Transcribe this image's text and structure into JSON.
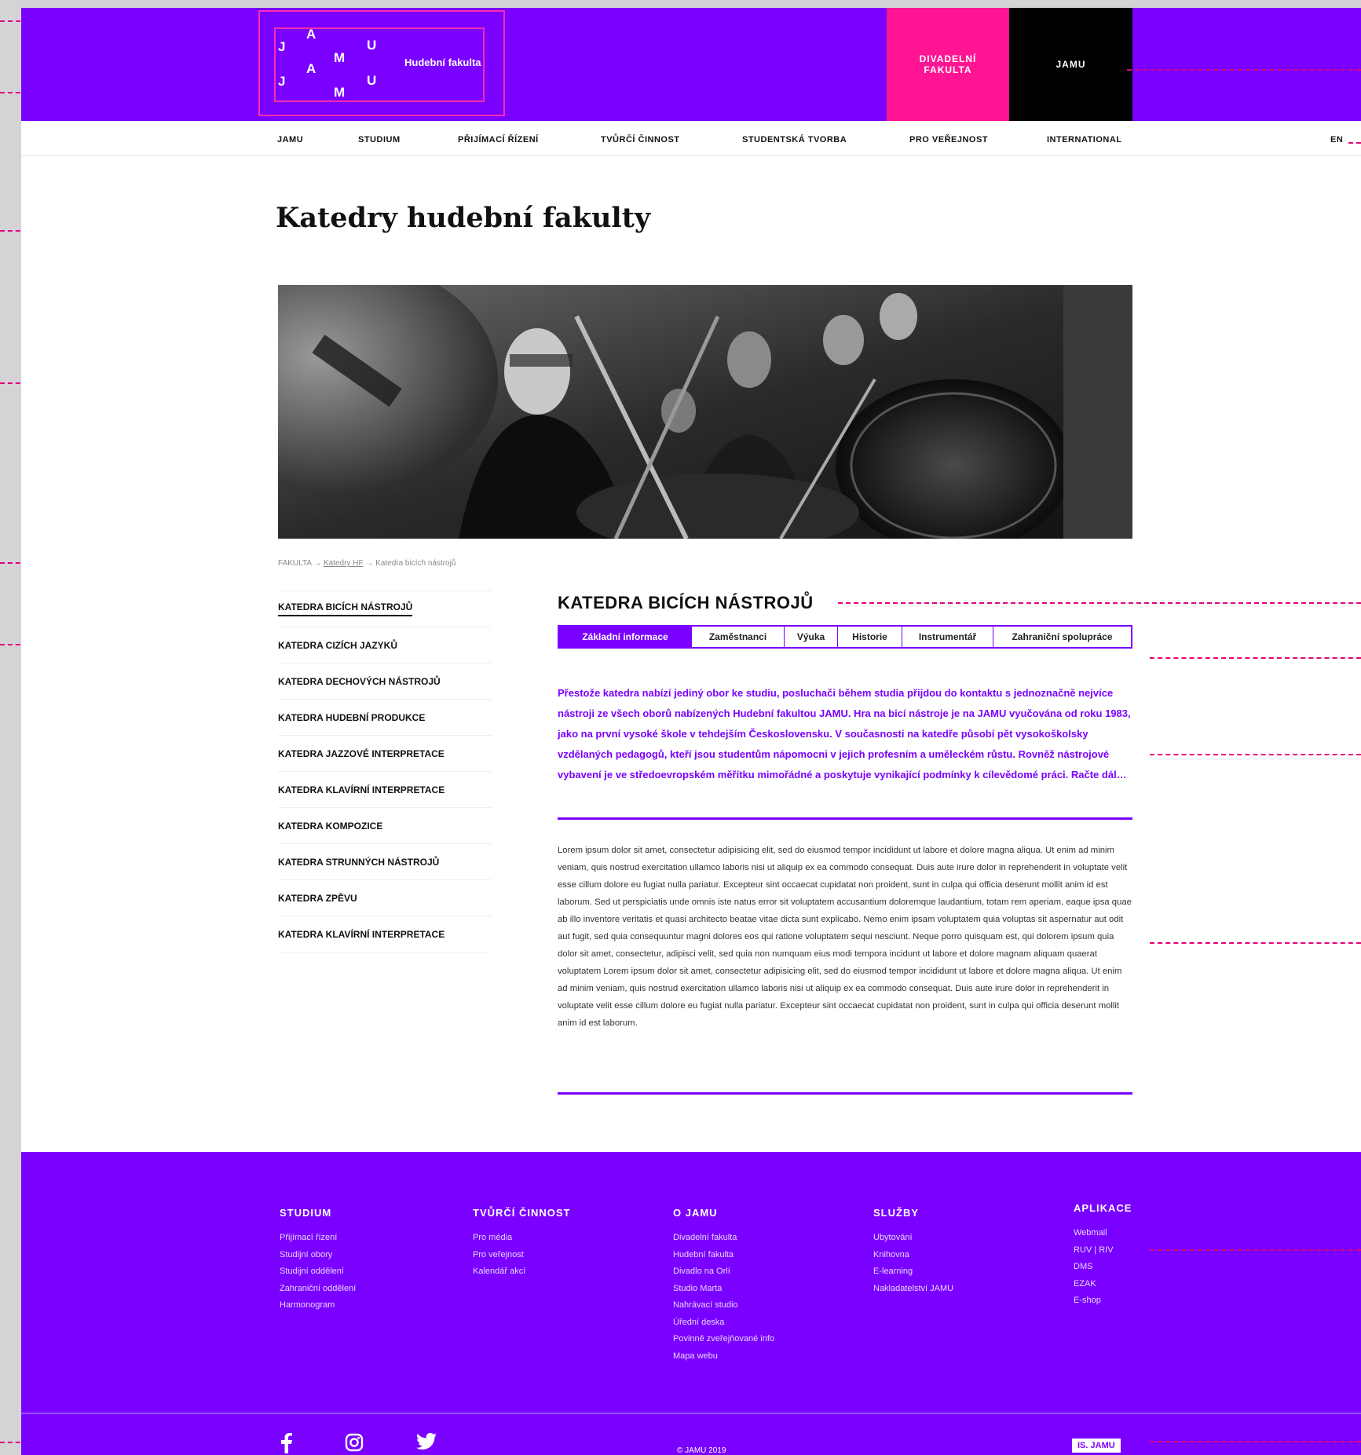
{
  "header": {
    "logo_letters": [
      "J",
      "A",
      "M",
      "U",
      "J",
      "A",
      "M",
      "U"
    ],
    "faculty": "Hudební fakulta",
    "tiles": [
      "DIVADELNÍ\nFAKULTA",
      "JAMU"
    ]
  },
  "nav": {
    "items": [
      "JAMU",
      "STUDIUM",
      "PŘIJÍMACÍ ŘÍZENÍ",
      "TVŮRČÍ ČINNOST",
      "STUDENTSKÁ TVORBA",
      "PRO VEŘEJNOST",
      "INTERNATIONAL"
    ],
    "lang": "EN"
  },
  "page": {
    "title": "Katedry hudební fakulty"
  },
  "breadcrumb": {
    "root": "FAKULTA",
    "sep": "→",
    "parent": "Katedry HF",
    "current": "Katedra bicích nástrojů"
  },
  "sidebar": {
    "items": [
      "KATEDRA BICÍCH NÁSTROJŮ",
      "KATEDRA CIZÍCH JAZYKŮ",
      "KATEDRA DECHOVÝCH NÁSTROJŮ",
      "KATEDRA HUDEBNÍ PRODUKCE",
      "KATEDRA JAZZOVÉ INTERPRETACE",
      "KATEDRA KLAVÍRNÍ INTERPRETACE",
      "KATEDRA KOMPOZICE",
      "KATEDRA STRUNNÝCH NÁSTROJŮ",
      "KATEDRA ZPĚVU",
      "KATEDRA KLAVÍRNÍ INTERPRETACE"
    ],
    "active_index": 0
  },
  "main": {
    "title": "KATEDRA BICÍCH NÁSTROJŮ",
    "tabs": [
      "Základní informace",
      "Zaměstnanci",
      "Výuka",
      "Historie",
      "Instrumentář",
      "Zahraniční spolupráce"
    ],
    "active_tab": 0,
    "lead": "Přestože katedra nabízí jediný obor ke studiu, posluchači během studia přijdou do kontaktu s jednoznačně nejvíce nástroji ze všech oborů nabízených Hudební fakultou JAMU. Hra na bicí nástroje je na JAMU vyučována od roku 1983, jako na první vysoké škole v tehdejším Československu. V současnosti na katedře působí pět vysokoškolsky vzdělaných pedagogů, kteří jsou studentům nápomocni v jejich profesním a uměleckém růstu. Rovněž nástrojové vybavení je ve středoevropském měřítku mimořádné a poskytuje vynikající podmínky k cílevědomé práci. Račte dál…",
    "body": "Lorem ipsum dolor sit amet, consectetur adipisicing elit, sed do eiusmod tempor incididunt ut labore et dolore magna aliqua. Ut enim ad minim veniam, quis nostrud exercitation ullamco laboris nisi ut aliquip ex ea commodo consequat. Duis aute irure dolor in reprehenderit in voluptate velit esse cillum dolore eu fugiat nulla pariatur. Excepteur sint occaecat cupidatat non proident, sunt in culpa qui officia deserunt mollit anim id est laborum. Sed ut perspiciatis unde omnis iste natus error sit voluptatem accusantium doloremque laudantium, totam rem aperiam, eaque ipsa quae ab illo inventore veritatis et quasi architecto beatae vitae dicta sunt explicabo. Nemo enim ipsam voluptatem quia voluptas sit aspernatur aut odit aut fugit, sed quia consequuntur magni dolores eos qui ratione voluptatem sequi nesciunt. Neque porro quisquam est, qui dolorem ipsum quia dolor sit amet, consectetur, adipisci velit, sed quia non numquam eius modi tempora incidunt ut labore et dolore magnam aliquam quaerat voluptatem Lorem ipsum dolor sit amet, consectetur adipisicing elit, sed do eiusmod tempor incididunt ut labore et dolore magna aliqua. Ut enim ad minim veniam, quis nostrud exercitation ullamco laboris nisi ut aliquip ex ea commodo consequat. Duis aute irure dolor in reprehenderit in voluptate velit esse cillum dolore eu fugiat nulla pariatur. Excepteur sint occaecat cupidatat non proident, sunt in culpa qui officia deserunt mollit anim id est laborum."
  },
  "footer": {
    "columns": [
      {
        "title": "STUDIUM",
        "links": [
          "Přijímací řízení",
          "Studijní obory",
          "Studijní oddělení",
          "Zahraniční oddělení",
          "Harmonogram"
        ]
      },
      {
        "title": "TVŮRČÍ ČINNOST",
        "links": [
          "Pro média",
          "Pro veřejnost",
          "Kalendář akcí"
        ]
      },
      {
        "title": "O JAMU",
        "links": [
          "Divadelní fakulta",
          "Hudební fakulta",
          "Divadlo na Orlí",
          "Studio Marta",
          "Nahrávací studio",
          "Úřední deska",
          "Povinně zveřejňované info",
          "Mapa webu"
        ]
      },
      {
        "title": "SLUŽBY",
        "links": [
          "Ubytování",
          "Knihovna",
          "E-learning",
          "Nakladatelství JAMU"
        ]
      },
      {
        "title": "APLIKACE",
        "links": [
          "Webmail",
          "RUV | RIV",
          "DMS",
          "EZAK",
          "E-shop"
        ]
      }
    ],
    "social": [
      "facebook-icon",
      "instagram-icon",
      "twitter-icon"
    ],
    "copyright": "© JAMU 2019",
    "is_link": "IS. JAMU"
  },
  "colors": {
    "brand_purple": "#7a00ff",
    "accent_pink": "#ff1493",
    "guide_pink": "#e5007d"
  }
}
